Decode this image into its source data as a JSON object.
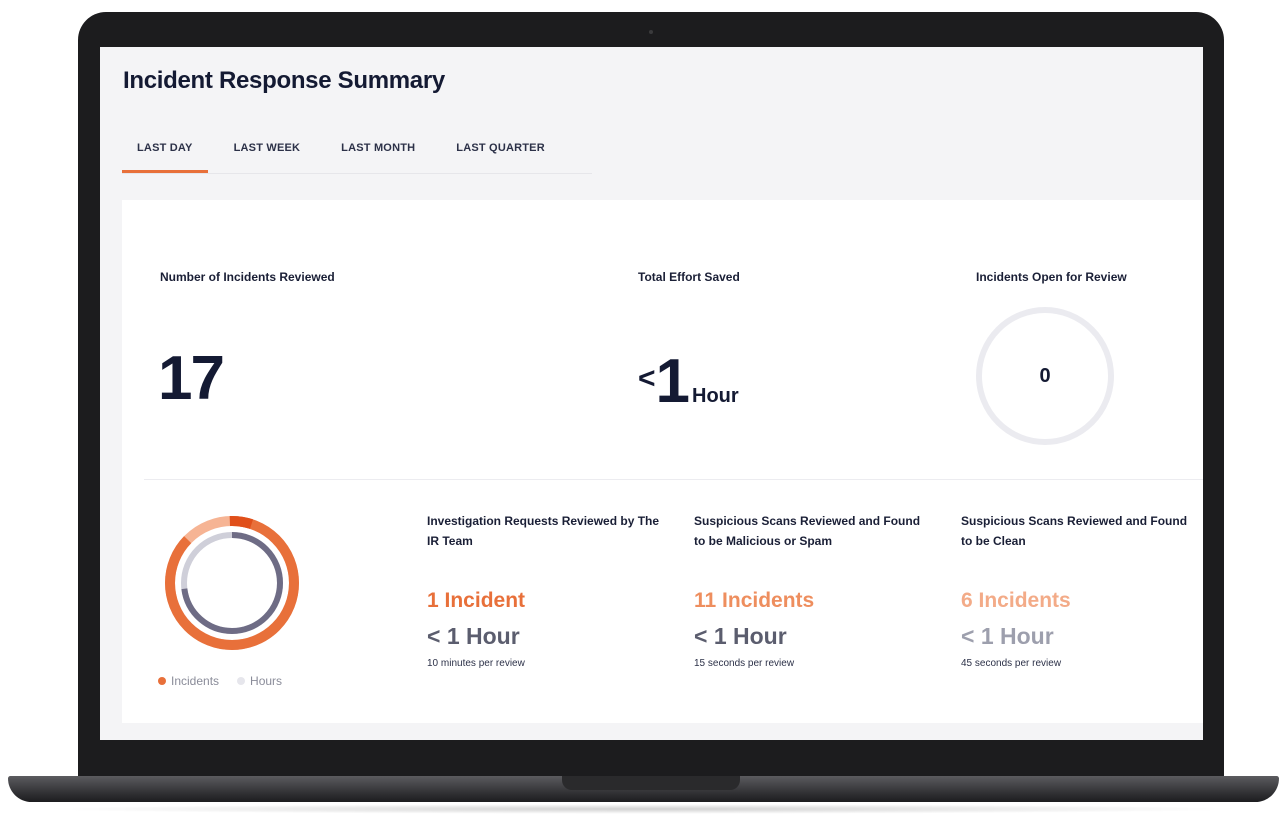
{
  "page": {
    "title": "Incident Response Summary"
  },
  "tabs": [
    {
      "label": "LAST DAY",
      "active": true
    },
    {
      "label": "LAST WEEK",
      "active": false
    },
    {
      "label": "LAST MONTH",
      "active": false
    },
    {
      "label": "LAST QUARTER",
      "active": false
    }
  ],
  "stats": {
    "reviewed": {
      "label": "Number of Incidents Reviewed",
      "value": "17"
    },
    "effort": {
      "label": "Total Effort Saved",
      "prefix": "<",
      "value": "1",
      "unit": "Hour"
    },
    "open": {
      "label": "Incidents Open for Review",
      "value": "0"
    }
  },
  "donut": {
    "legend": {
      "incidents": "Incidents",
      "hours": "Hours"
    },
    "colors": {
      "incidents": "#e8703a",
      "incidents_light": "#f6b494",
      "hours": "#6e6c85",
      "hours_light": "#cfcfd9"
    }
  },
  "metrics": [
    {
      "title": "Investigation Requests Reviewed by The IR Team",
      "count": "1 Incident",
      "time": "< 1 Hour",
      "rate": "10 minutes per review",
      "count_color": "#e8703a"
    },
    {
      "title": "Suspicious Scans Reviewed and Found to be Malicious or Spam",
      "count": "11 Incidents",
      "time": "< 1 Hour",
      "rate": "15 seconds per review",
      "count_color": "#ee8e5e"
    },
    {
      "title": "Suspicious Scans Reviewed and Found to be Clean",
      "count": "6 Incidents",
      "time": "< 1 Hour",
      "rate": "45 seconds per review",
      "count_color": "#f3ab88"
    }
  ]
}
